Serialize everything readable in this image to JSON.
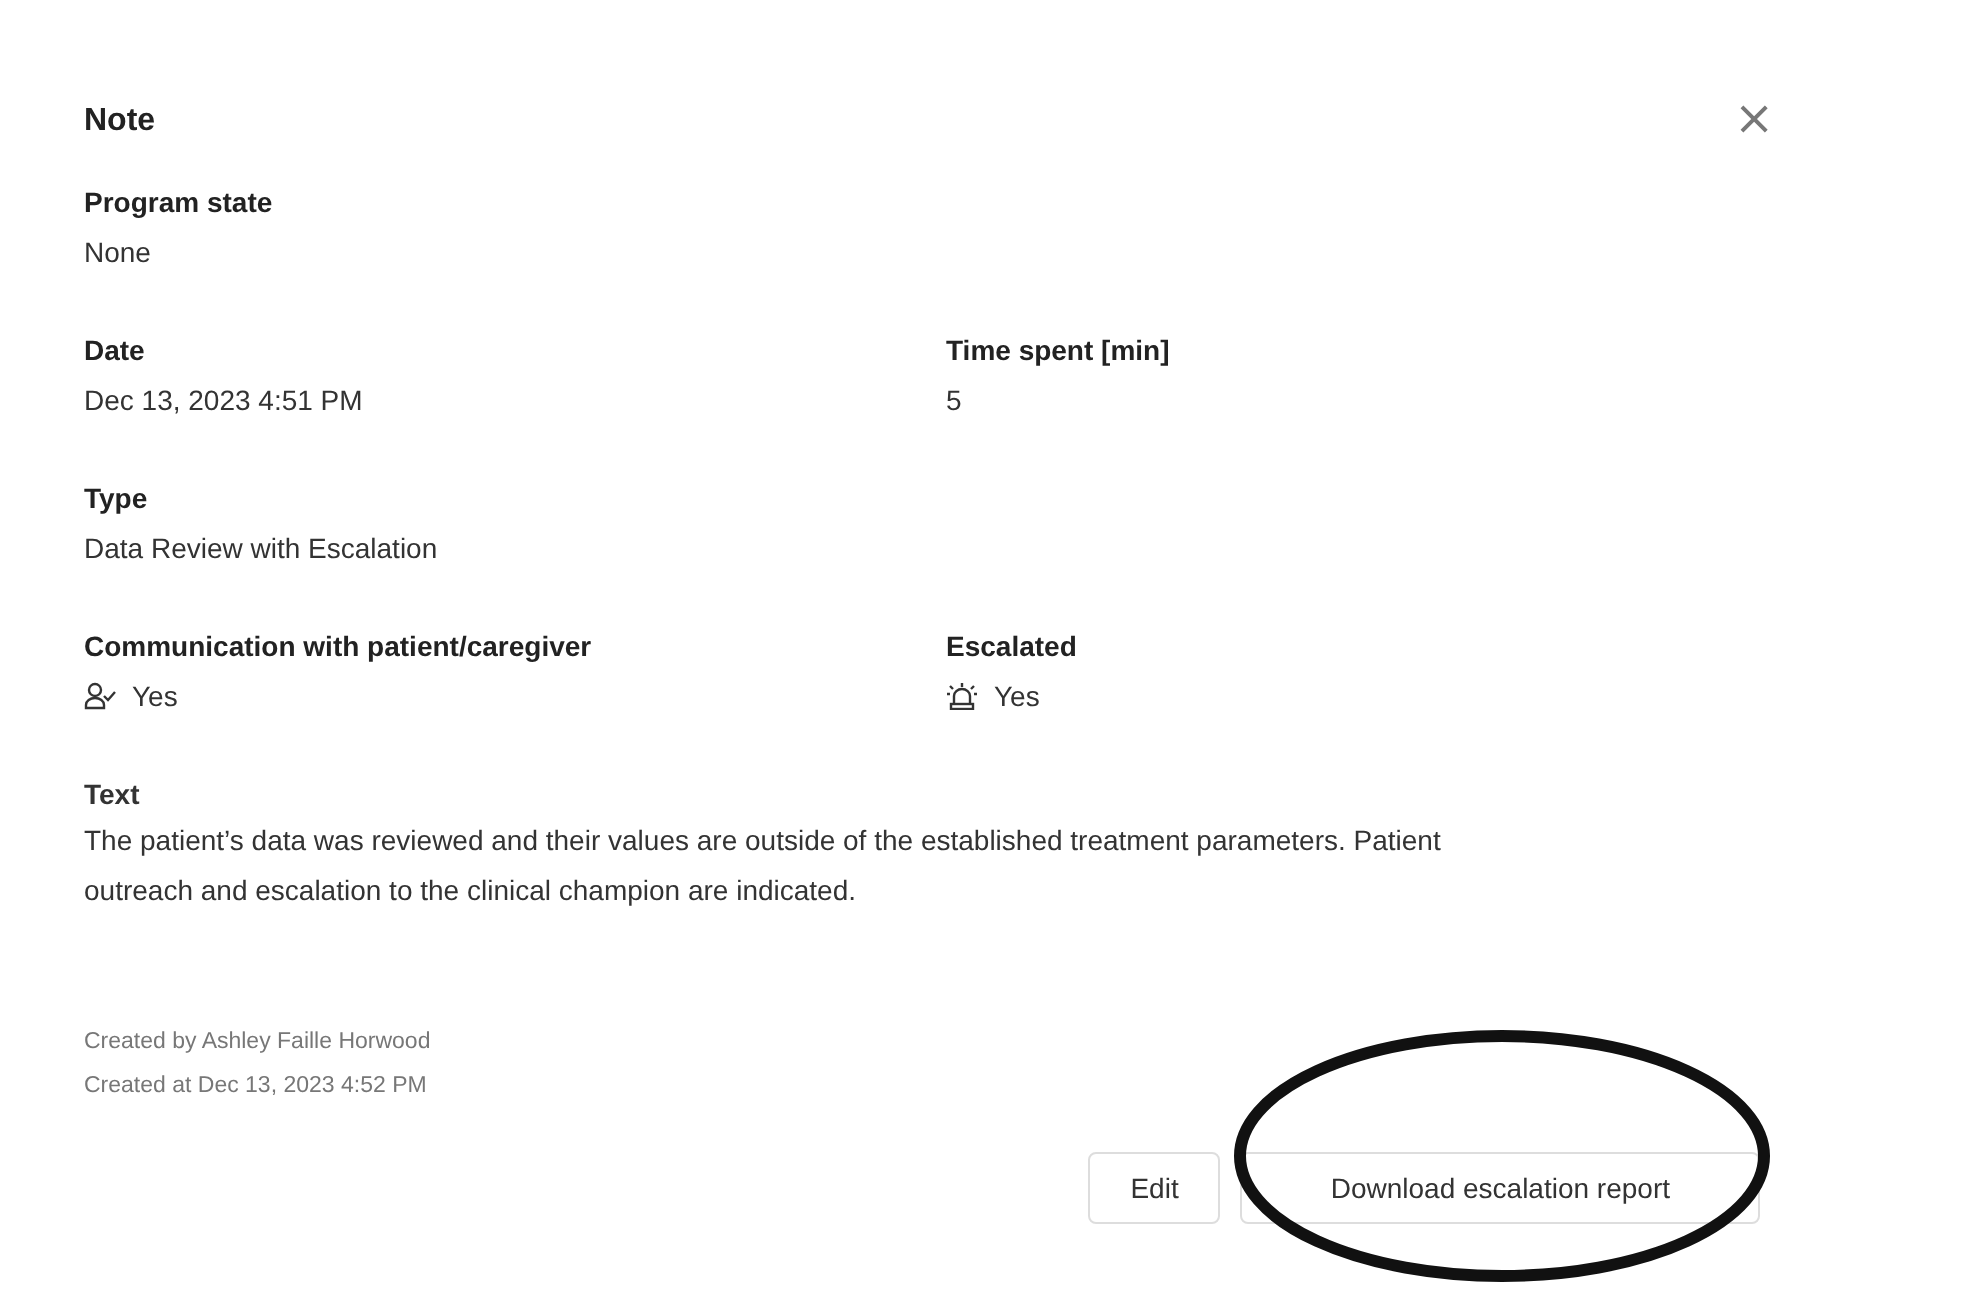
{
  "dialog": {
    "title": "Note",
    "close": "×"
  },
  "rows": [
    [
      {
        "label": "Program state",
        "value": "None",
        "kind": "plain"
      }
    ],
    [
      {
        "label": "Date",
        "value": "Dec 13, 2023 4:51 PM",
        "kind": "plain"
      },
      {
        "label": "Time spent [min]",
        "value": "5",
        "kind": "plain"
      }
    ],
    [
      {
        "label": "Type",
        "value": "Data Review with Escalation",
        "kind": "plain"
      }
    ],
    [
      {
        "label": "Communication with patient/caregiver",
        "value": "Yes",
        "kind": "contact"
      },
      {
        "label": "Escalated",
        "value": "Yes",
        "kind": "escalation"
      }
    ],
    [
      {
        "label": "Text",
        "value": "The patient’s data was reviewed and their values are outside of the established treatment parameters. Patient outreach and escalation to the clinical champion are indicated.",
        "kind": "paragraph"
      }
    ]
  ],
  "footer": [
    "Created by Ashley Faille Horwood",
    "Created at Dec 13, 2023 4:52 PM"
  ],
  "buttons": [
    "Edit",
    "Download escalation report"
  ]
}
